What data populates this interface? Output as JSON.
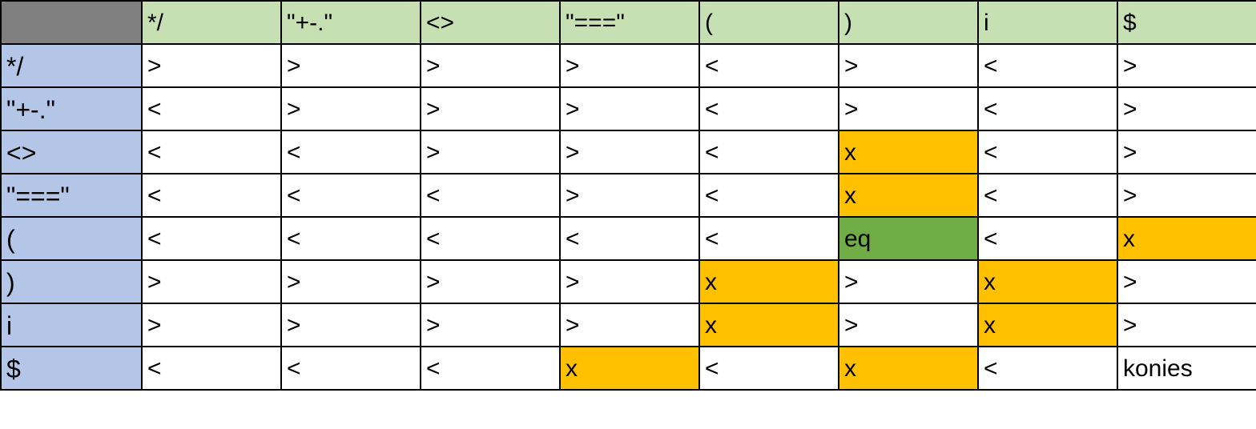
{
  "colors": {
    "corner": "#808080",
    "column_header": "#c6e0b4",
    "row_header": "#b4c6e7",
    "cell": "#ffffff",
    "highlight_x": "#ffc000",
    "highlight_eq": "#70ad47"
  },
  "table": {
    "columns": [
      "*/",
      "\"+-.\"",
      "<>",
      "\"===\"",
      "(",
      ")",
      "i",
      "$"
    ],
    "rows": [
      {
        "label": "*/",
        "cells": [
          ">",
          ">",
          ">",
          ">",
          "<",
          ">",
          "<",
          ">"
        ],
        "fill": [
          "cell",
          "cell",
          "cell",
          "cell",
          "cell",
          "cell",
          "cell",
          "cell"
        ]
      },
      {
        "label": "\"+-.\"",
        "cells": [
          "<",
          ">",
          ">",
          ">",
          "<",
          ">",
          "<",
          ">"
        ],
        "fill": [
          "cell",
          "cell",
          "cell",
          "cell",
          "cell",
          "cell",
          "cell",
          "cell"
        ]
      },
      {
        "label": "<>",
        "cells": [
          "<",
          "<",
          ">",
          ">",
          "<",
          "x",
          "<",
          ">"
        ],
        "fill": [
          "cell",
          "cell",
          "cell",
          "cell",
          "cell",
          "highlight_x",
          "cell",
          "cell"
        ]
      },
      {
        "label": "\"===\"",
        "cells": [
          "<",
          "<",
          "<",
          ">",
          "<",
          "x",
          "<",
          ">"
        ],
        "fill": [
          "cell",
          "cell",
          "cell",
          "cell",
          "cell",
          "highlight_x",
          "cell",
          "cell"
        ]
      },
      {
        "label": "(",
        "cells": [
          "<",
          "<",
          "<",
          "<",
          "<",
          "eq",
          "<",
          "x"
        ],
        "fill": [
          "cell",
          "cell",
          "cell",
          "cell",
          "cell",
          "highlight_eq",
          "cell",
          "highlight_x"
        ]
      },
      {
        "label": ")",
        "cells": [
          ">",
          ">",
          ">",
          ">",
          "x",
          ">",
          "x",
          ">"
        ],
        "fill": [
          "cell",
          "cell",
          "cell",
          "cell",
          "highlight_x",
          "cell",
          "highlight_x",
          "cell"
        ]
      },
      {
        "label": "i",
        "cells": [
          ">",
          ">",
          ">",
          ">",
          "x",
          ">",
          "x",
          ">"
        ],
        "fill": [
          "cell",
          "cell",
          "cell",
          "cell",
          "highlight_x",
          "cell",
          "highlight_x",
          "cell"
        ]
      },
      {
        "label": "$",
        "cells": [
          "<",
          "<",
          "<",
          "x",
          "<",
          "x",
          "<",
          "konies"
        ],
        "fill": [
          "cell",
          "cell",
          "cell",
          "highlight_x",
          "cell",
          "highlight_x",
          "cell",
          "cell"
        ]
      }
    ]
  }
}
